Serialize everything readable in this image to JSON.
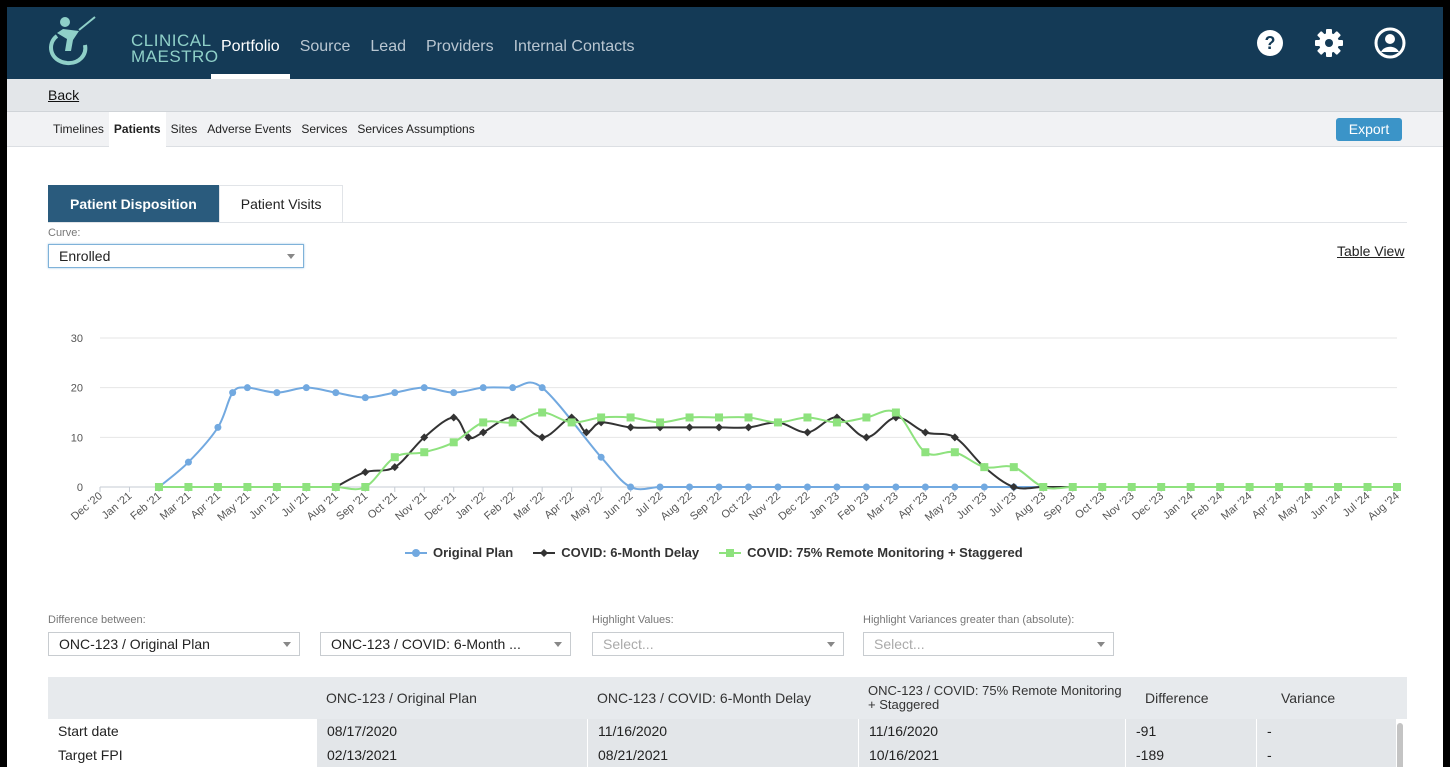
{
  "header": {
    "logo_line1": "CLINICAL",
    "logo_line2": "MAESTRO",
    "nav": [
      {
        "label": "Portfolio",
        "active": true
      },
      {
        "label": "Source",
        "active": false
      },
      {
        "label": "Lead",
        "active": false
      },
      {
        "label": "Providers",
        "active": false
      },
      {
        "label": "Internal Contacts",
        "active": false
      }
    ],
    "icons": [
      "help-icon",
      "settings-icon",
      "user-account-icon"
    ]
  },
  "back_label": "Back",
  "subtabs": [
    {
      "label": "Timelines",
      "active": false
    },
    {
      "label": "Patients",
      "active": true
    },
    {
      "label": "Sites",
      "active": false
    },
    {
      "label": "Adverse Events",
      "active": false
    },
    {
      "label": "Services",
      "active": false
    },
    {
      "label": "Services Assumptions",
      "active": false
    }
  ],
  "export_label": "Export",
  "view_tabs": [
    {
      "label": "Patient Disposition",
      "active": true
    },
    {
      "label": "Patient Visits",
      "active": false
    }
  ],
  "curve": {
    "label": "Curve:",
    "value": "Enrolled"
  },
  "table_view_label": "Table View",
  "chart_data": {
    "type": "line",
    "title": "",
    "xlabel": "",
    "ylabel": "",
    "ylim": [
      0,
      30
    ],
    "y_ticks": [
      0,
      10,
      20,
      30
    ],
    "grid": true,
    "legend_placement": "bottom-center",
    "categories": [
      "Dec '20",
      "Jan '21",
      "Feb '21",
      "Mar '21",
      "Apr '21",
      "May '21",
      "Jun '21",
      "Jul '21",
      "Aug '21",
      "Sep '21",
      "Oct '21",
      "Nov '21",
      "Dec '21",
      "Jan '22",
      "Feb '22",
      "Mar '22",
      "Apr '22",
      "May '22",
      "Jun '22",
      "Jul '22",
      "Aug '22",
      "Sep '22",
      "Oct '22",
      "Nov '22",
      "Dec '22",
      "Jan '23",
      "Feb '23",
      "Mar '23",
      "Apr '23",
      "May '23",
      "Jun '23",
      "Jul '23",
      "Aug '23",
      "Sep '23",
      "Oct '23",
      "Nov '23",
      "Dec '23",
      "Jan '24",
      "Feb '24",
      "Mar '24",
      "Apr '24",
      "May '24",
      "Jun '24",
      "Jul '24",
      "Aug '24"
    ],
    "series": [
      {
        "name": "Original Plan",
        "color": "#72a9e0",
        "marker": "circle",
        "x": [
          "Feb '21",
          "Mar '21",
          "Apr '21",
          "Apr '21",
          "May '21",
          "Jun '21",
          "Jul '21",
          "Aug '21",
          "Sep '21",
          "Oct '21",
          "Nov '21",
          "Dec '21",
          "Jan '22",
          "Feb '22",
          "Mar '22",
          "May '22",
          "Jun '22",
          "Jul '22",
          "Aug '22",
          "Sep '22",
          "Oct '22",
          "Nov '22",
          "Dec '22",
          "Jan '23",
          "Feb '23",
          "Mar '23",
          "Apr '23",
          "May '23",
          "Jun '23",
          "Jul '23",
          "Aug '23",
          "Sep '23",
          "Oct '23",
          "Nov '23",
          "Dec '23",
          "Jan '24",
          "Feb '24",
          "Mar '24",
          "Apr '24",
          "May '24",
          "Jun '24",
          "Jul '24",
          "Aug '24"
        ],
        "values": [
          0,
          5,
          12,
          19,
          20,
          19,
          20,
          19,
          18,
          19,
          20,
          19,
          20,
          20,
          20,
          6,
          0,
          0,
          0,
          0,
          0,
          0,
          0,
          0,
          0,
          0,
          0,
          0,
          0,
          0,
          0,
          0,
          0,
          0,
          0,
          0,
          0,
          0,
          0,
          0,
          0,
          0,
          0
        ]
      },
      {
        "name": "COVID: 6-Month Delay",
        "color": "#333333",
        "marker": "diamond",
        "x": [
          "Aug '21",
          "Sep '21",
          "Oct '21",
          "Nov '21",
          "Dec '21",
          "Dec '21",
          "Jan '22",
          "Feb '22",
          "Mar '22",
          "Apr '22",
          "Apr '22",
          "May '22",
          "Jun '22",
          "Jul '22",
          "Aug '22",
          "Sep '22",
          "Oct '22",
          "Nov '22",
          "Dec '22",
          "Jan '23",
          "Feb '23",
          "Mar '23",
          "Apr '23",
          "May '23",
          "Jun '23",
          "Jul '23",
          "Aug '23",
          "Sep '23",
          "Oct '23",
          "Nov '23",
          "Dec '23",
          "Jan '24",
          "Feb '24",
          "Mar '24",
          "Apr '24",
          "May '24",
          "Jun '24",
          "Jul '24",
          "Aug '24"
        ],
        "values": [
          0,
          3,
          4,
          10,
          14,
          10,
          11,
          14,
          10,
          14,
          11,
          13,
          12,
          12,
          12,
          12,
          12,
          13,
          11,
          14,
          10,
          14,
          11,
          10,
          4,
          0,
          0,
          0,
          0,
          0,
          0,
          0,
          0,
          0,
          0,
          0,
          0,
          0,
          0
        ]
      },
      {
        "name": "COVID: 75% Remote Monitoring + Staggered",
        "color": "#8ee27e",
        "marker": "square",
        "x": [
          "Feb '21",
          "Mar '21",
          "Apr '21",
          "May '21",
          "Jun '21",
          "Jul '21",
          "Aug '21",
          "Sep '21",
          "Oct '21",
          "Nov '21",
          "Dec '21",
          "Jan '22",
          "Feb '22",
          "Mar '22",
          "Apr '22",
          "May '22",
          "Jun '22",
          "Jul '22",
          "Aug '22",
          "Sep '22",
          "Oct '22",
          "Nov '22",
          "Dec '22",
          "Jan '23",
          "Feb '23",
          "Mar '23",
          "Apr '23",
          "May '23",
          "Jun '23",
          "Jul '23",
          "Aug '23",
          "Sep '23",
          "Oct '23",
          "Nov '23",
          "Dec '23",
          "Jan '24",
          "Feb '24",
          "Mar '24",
          "Apr '24",
          "May '24",
          "Jun '24",
          "Jul '24",
          "Aug '24"
        ],
        "values": [
          0,
          0,
          0,
          0,
          0,
          0,
          0,
          0,
          6,
          7,
          9,
          13,
          13,
          15,
          13,
          14,
          14,
          13,
          14,
          14,
          14,
          13,
          14,
          13,
          14,
          15,
          7,
          7,
          4,
          4,
          0,
          0,
          0,
          0,
          0,
          0,
          0,
          0,
          0,
          0,
          0,
          0,
          0
        ]
      }
    ]
  },
  "filters": {
    "difference_label": "Difference between:",
    "diff_a": "ONC-123 / Original Plan",
    "diff_b": "ONC-123 / COVID: 6-Month ...",
    "highlight_values_label": "Highlight Values:",
    "highlight_values_placeholder": "Select...",
    "highlight_variances_label": "Highlight Variances greater than (absolute):",
    "highlight_variances_placeholder": "Select..."
  },
  "table": {
    "columns": [
      "",
      "ONC-123 / Original Plan",
      "ONC-123 / COVID: 6-Month Delay",
      "ONC-123 / COVID: 75% Remote Monitoring + Staggered",
      "Difference",
      "Variance"
    ],
    "rows": [
      [
        "Start date",
        "08/17/2020",
        "11/16/2020",
        "11/16/2020",
        "-91",
        "-"
      ],
      [
        "Target FPI",
        "02/13/2021",
        "08/21/2021",
        "10/16/2021",
        "-189",
        "-"
      ]
    ]
  }
}
